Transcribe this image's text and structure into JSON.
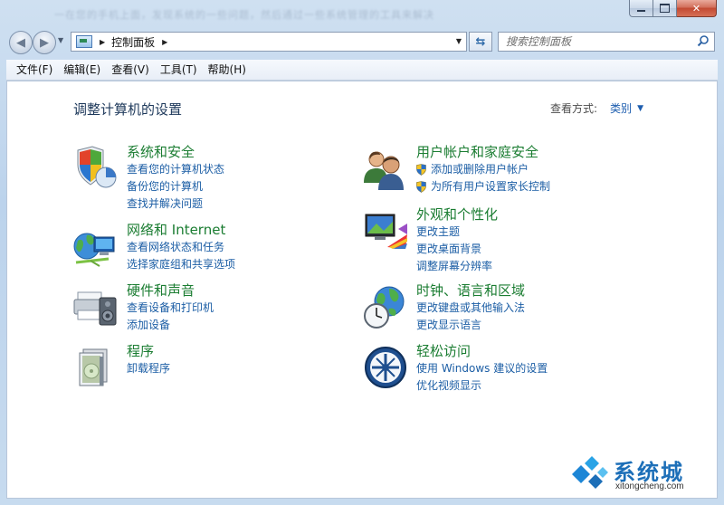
{
  "window": {
    "background_text": "一在您的手机上面，发现系统的一些问题，然后通过一些系统管理的工具来解决"
  },
  "nav": {
    "address_path": "控制面板",
    "search_placeholder": "搜索控制面板"
  },
  "menu": [
    "文件(F)",
    "编辑(E)",
    "查看(V)",
    "工具(T)",
    "帮助(H)"
  ],
  "header": {
    "title": "调整计算机的设置",
    "view_by_label": "查看方式:",
    "view_by_value": "类别"
  },
  "categories_left": [
    {
      "icon": "system-security-icon",
      "title": "系统和安全",
      "links": [
        "查看您的计算机状态",
        "备份您的计算机",
        "查找并解决问题"
      ]
    },
    {
      "icon": "network-internet-icon",
      "title": "网络和 Internet",
      "links": [
        "查看网络状态和任务",
        "选择家庭组和共享选项"
      ]
    },
    {
      "icon": "hardware-sound-icon",
      "title": "硬件和声音",
      "links": [
        "查看设备和打印机",
        "添加设备"
      ]
    },
    {
      "icon": "programs-icon",
      "title": "程序",
      "links": [
        "卸载程序"
      ]
    }
  ],
  "categories_right": [
    {
      "icon": "user-accounts-icon",
      "title": "用户帐户和家庭安全",
      "links": [
        "添加或删除用户帐户",
        "为所有用户设置家长控制"
      ],
      "shielded": true
    },
    {
      "icon": "appearance-icon",
      "title": "外观和个性化",
      "links": [
        "更改主题",
        "更改桌面背景",
        "调整屏幕分辨率"
      ]
    },
    {
      "icon": "clock-region-icon",
      "title": "时钟、语言和区域",
      "links": [
        "更改键盘或其他输入法",
        "更改显示语言"
      ]
    },
    {
      "icon": "ease-of-access-icon",
      "title": "轻松访问",
      "links": [
        "使用 Windows 建议的设置",
        "优化视频显示"
      ]
    }
  ],
  "watermark": {
    "brand": "系统城",
    "url": "xitongcheng.com"
  },
  "colors": {
    "category_title": "#1b7d32",
    "link": "#1c5ea5",
    "page_title": "#1e395b"
  }
}
